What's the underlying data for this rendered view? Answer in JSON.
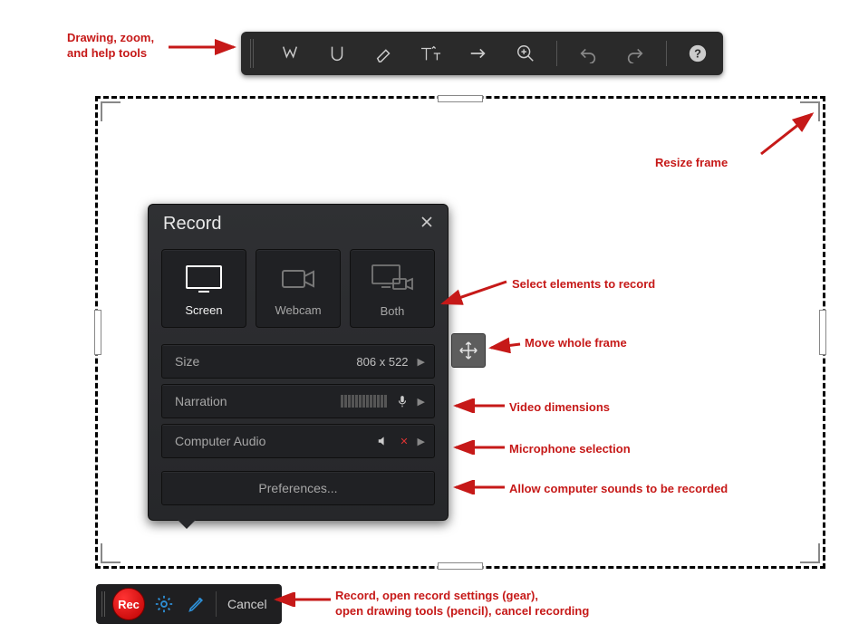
{
  "annotations": {
    "tools": "Drawing, zoom,\nand help tools",
    "resize": "Resize frame",
    "select_elements": "Select elements to record",
    "move_frame": "Move whole frame",
    "video_dims": "Video dimensions",
    "mic": "Microphone selection",
    "computer_audio": "Allow computer sounds to be recorded",
    "bottom": "Record, open record settings (gear),\nopen drawing tools (pencil), cancel recording"
  },
  "panel": {
    "title": "Record",
    "sources": {
      "screen": "Screen",
      "webcam": "Webcam",
      "both": "Both"
    },
    "size_label": "Size",
    "size_value": "806 x 522",
    "narration_label": "Narration",
    "computer_audio_label": "Computer Audio",
    "prefs": "Preferences..."
  },
  "bottom_bar": {
    "rec": "Rec",
    "cancel": "Cancel"
  }
}
